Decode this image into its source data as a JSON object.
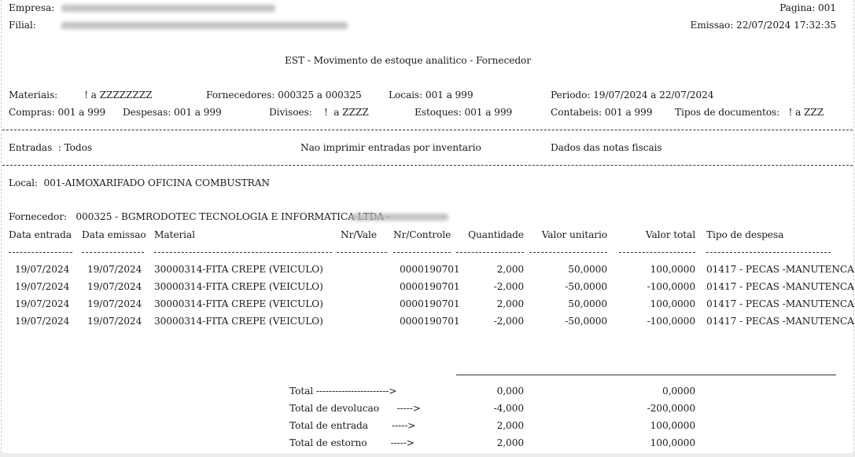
{
  "header": {
    "empresa_label": "Empresa:",
    "filial_label": "Filial:",
    "pagina_label": "Pagina: 001",
    "emissao_label": "Emissao: 22/07/2024 17:32:35",
    "report_title": "EST - Movimento de estoque analitico - Fornecedor"
  },
  "filters": {
    "materiais": "Materiais:         ! a ZZZZZZZZ",
    "fornecedores": "Fornecedores: 000325 a 000325",
    "locais": "Locais: 001 a 999",
    "periodo": "Periodo: 19/07/2024 a 22/07/2024",
    "compras": "Compras: 001 a 999",
    "despesas": "Despesas: 001 a 999",
    "divisoes": "Divisoes:    !  a ZZZZ",
    "estoques": "Estoques: 001 a 999",
    "contabeis": "Contabeis: 001 a 999",
    "tipos_documentos": "Tipos de documentos:   ! a ZZZ"
  },
  "options": {
    "entradas": "Entradas  : Todos",
    "nao_imprimir": "Nao imprimir entradas por inventario",
    "dados_notas": "Dados das notas fiscais"
  },
  "local": "Local:  001-AIMOXARIFADO OFICINA COMBUSTRAN",
  "fornecedor": "Fornecedor:   000325 - BGMRODOTEC TECNOLOGIA E INFORMATICA LTDA -",
  "columns": {
    "data_entrada": "Data entrada",
    "data_emissao": "Data emissao",
    "material": "Material",
    "nr_vale": "Nr/Vale",
    "nr_controle": "Nr/Controle",
    "quantidade": "Quantidade",
    "valor_unitario": "Valor unitario",
    "valor_total": "Valor total",
    "tipo_despesa": "Tipo de despesa"
  },
  "rows": [
    {
      "data_entrada": "19/07/2024",
      "data_emissao": "19/07/2024",
      "material": "30000314-FITA CREPE (VEICULO)",
      "nr_controle": "0000190701",
      "quantidade": "2,000",
      "valor_unitario": "50,0000",
      "valor_total": "100,0000",
      "tipo_despesa": "01417 - PECAS -MANUTENCA"
    },
    {
      "data_entrada": "19/07/2024",
      "data_emissao": "19/07/2024",
      "material": "30000314-FITA CREPE (VEICULO)",
      "nr_controle": "0000190701",
      "quantidade": "-2,000",
      "valor_unitario": "-50,0000",
      "valor_total": "-100,0000",
      "tipo_despesa": "01417 - PECAS -MANUTENCA"
    },
    {
      "data_entrada": "19/07/2024",
      "data_emissao": "19/07/2024",
      "material": "30000314-FITA CREPE (VEICULO)",
      "nr_controle": "0000190701",
      "quantidade": "2,000",
      "valor_unitario": "50,0000",
      "valor_total": "100,0000",
      "tipo_despesa": "01417 - PECAS -MANUTENCA"
    },
    {
      "data_entrada": "19/07/2024",
      "data_emissao": "19/07/2024",
      "material": "30000314-FITA CREPE (VEICULO)",
      "nr_controle": "0000190701",
      "quantidade": "-2,000",
      "valor_unitario": "-50,0000",
      "valor_total": "-100,0000",
      "tipo_despesa": "01417 - PECAS -MANUTENCA"
    }
  ],
  "totals": [
    {
      "label": "Total ----------------------->",
      "quantidade": "0,000",
      "valor_total": "0,0000"
    },
    {
      "label": "Total de devolucao      ----->",
      "quantidade": "-4,000",
      "valor_total": "-200,0000"
    },
    {
      "label": "Total de entrada        ----->",
      "quantidade": "2,000",
      "valor_total": "100,0000"
    },
    {
      "label": "Total de estorno        ----->",
      "quantidade": "2,000",
      "valor_total": "100,0000"
    }
  ]
}
